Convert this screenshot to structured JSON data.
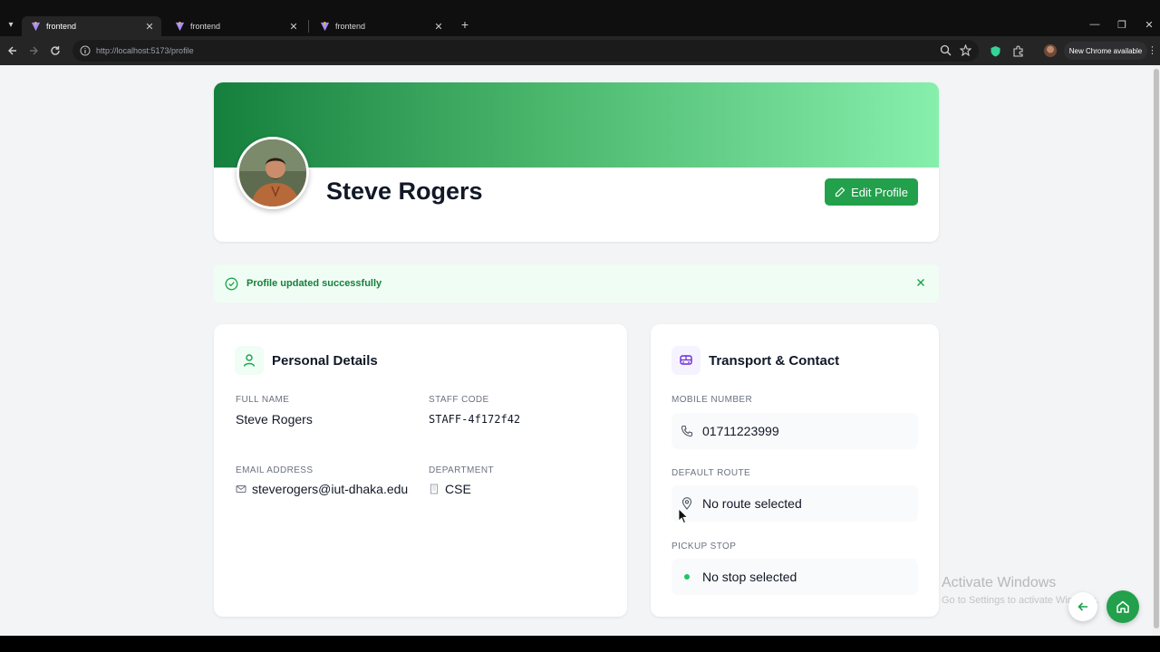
{
  "browser": {
    "tabs": [
      {
        "title": "frontend",
        "active": true
      },
      {
        "title": "frontend",
        "active": false
      },
      {
        "title": "frontend",
        "active": false
      }
    ],
    "url": "http://localhost:5173/profile",
    "update_label": "New Chrome available"
  },
  "profile": {
    "name": "Steve Rogers",
    "edit_label": "Edit Profile",
    "banner_colors": [
      "#15803d",
      "#86efac"
    ]
  },
  "alert": {
    "message": "Profile updated successfully"
  },
  "personal": {
    "title": "Personal Details",
    "fields": [
      {
        "label": "FULL NAME",
        "value": "Steve Rogers"
      },
      {
        "label": "STAFF CODE",
        "value": "STAFF-4f172f42"
      },
      {
        "label": "EMAIL ADDRESS",
        "value": "steverogers@iut-dhaka.edu"
      },
      {
        "label": "DEPARTMENT",
        "value": "CSE"
      }
    ]
  },
  "transport": {
    "title": "Transport & Contact",
    "fields": [
      {
        "label": "MOBILE NUMBER",
        "value": "01711223999"
      },
      {
        "label": "DEFAULT ROUTE",
        "value": "No route selected"
      },
      {
        "label": "PICKUP STOP",
        "value": "No stop selected"
      }
    ]
  },
  "watermark": {
    "title": "Activate Windows",
    "subtitle": "Go to Settings to activate Windows."
  },
  "colors": {
    "accent": "#22a04b",
    "success_text": "#15803d",
    "success_bg": "#f0fdf4",
    "transport_icon": "#6d28d9"
  },
  "icons": [
    "user-icon",
    "bus-icon",
    "phone-icon",
    "map-pin-icon",
    "mail-icon",
    "building-icon",
    "check-circle-icon",
    "close-icon",
    "pencil-icon",
    "home-icon",
    "arrow-left-icon"
  ]
}
